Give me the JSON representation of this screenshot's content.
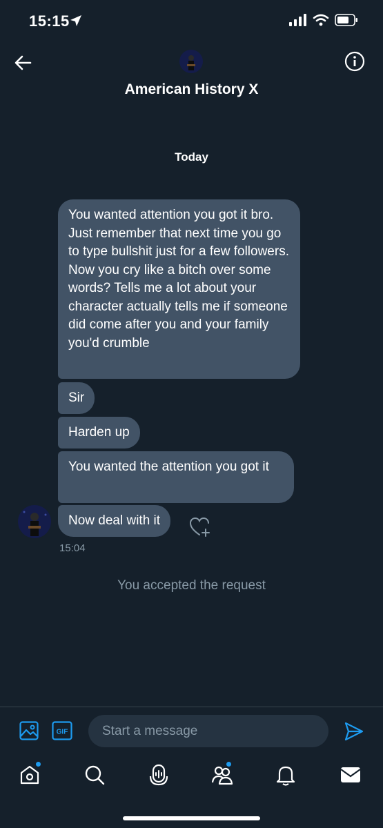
{
  "status_bar": {
    "time": "15:15"
  },
  "header": {
    "title": "American History X"
  },
  "date_label": "Today",
  "messages": [
    "You wanted attention you got it bro. Just remember that next time you go to type bullshit just for a few followers. Now you cry like a bitch over some words? Tells me a lot about your character actually tells me if someone did come after you and your family you'd crumble",
    "Sir",
    "Harden up",
    "You wanted the attention you got it",
    "Now deal with it"
  ],
  "last_message_time": "15:04",
  "system_message": "You accepted the request",
  "composer": {
    "placeholder": "Start a message",
    "gif_label": "GIF"
  },
  "colors": {
    "background": "#15202b",
    "bubble": "#425366",
    "accent": "#1d9bf0",
    "muted": "#8899a6"
  },
  "icons": [
    "back-arrow-icon",
    "info-icon",
    "location-arrow-icon",
    "signal-icon",
    "wifi-icon",
    "battery-icon",
    "image-icon",
    "gif-icon",
    "send-icon",
    "heart-plus-icon",
    "home-icon",
    "search-icon",
    "spaces-icon",
    "communities-icon",
    "bell-icon",
    "mail-icon"
  ]
}
